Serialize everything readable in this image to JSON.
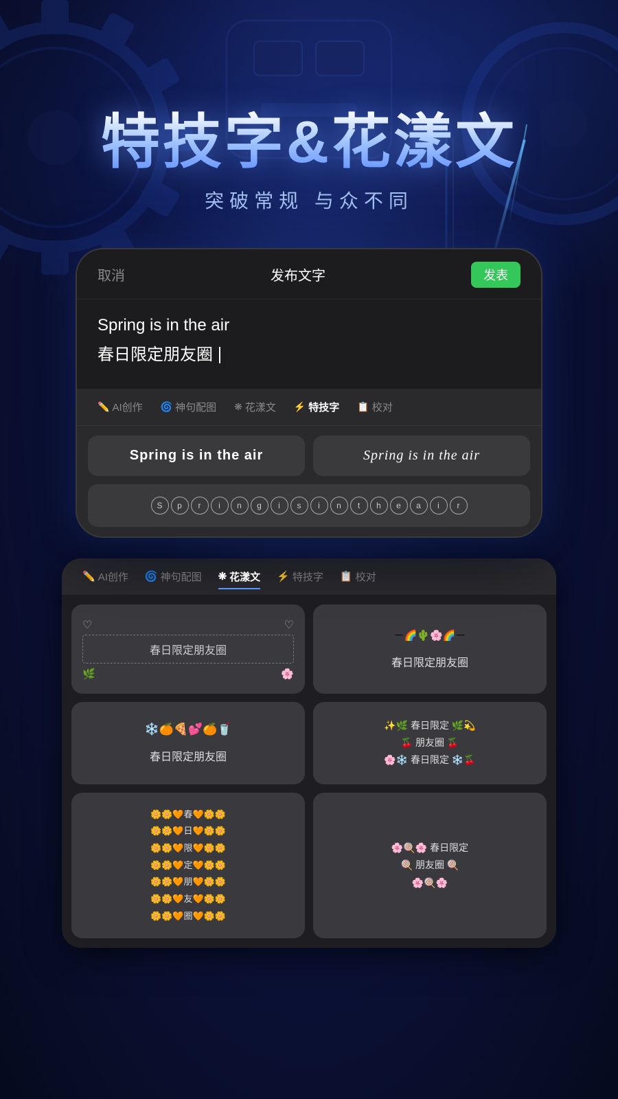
{
  "hero": {
    "title_main": "特技字&花漾文",
    "title_sub": "突破常规 与众不同"
  },
  "phone": {
    "header": {
      "cancel": "取消",
      "title": "发布文字",
      "publish": "发表"
    },
    "content": {
      "line1": "Spring is in the air",
      "line2": "春日限定朋友圈"
    },
    "toolbar_tabs": [
      {
        "label": "AI创作",
        "icon": "✏️",
        "active": false
      },
      {
        "label": "神句配图",
        "icon": "🌀",
        "active": false
      },
      {
        "label": "花漾文",
        "icon": "❋",
        "active": false
      },
      {
        "label": "特技字",
        "icon": "⚡",
        "active": true
      },
      {
        "label": "校对",
        "icon": "📋",
        "active": false
      }
    ],
    "style_option1": "Spring is in the air",
    "style_option2": "Spring is in the air",
    "style_circle_text": "Spring is in the air"
  },
  "bottom_panel": {
    "toolbar_tabs": [
      {
        "label": "AI创作",
        "icon": "✏️",
        "active": false
      },
      {
        "label": "神句配图",
        "icon": "🌀",
        "active": false
      },
      {
        "label": "花漾文",
        "icon": "❋",
        "active": true
      },
      {
        "label": "特技字",
        "icon": "⚡",
        "active": false
      },
      {
        "label": "校对",
        "icon": "📋",
        "active": false
      }
    ],
    "cards": [
      {
        "id": "card1",
        "hearts_top": "♡ ♡",
        "text": "春日限定朋友圈",
        "bottom_emojis": "🌿 🌸"
      },
      {
        "id": "card2",
        "top_emojis": "－🌈🌵🌸🌈－",
        "text": "春日限定朋友圈"
      },
      {
        "id": "card3",
        "top_emojis": "❄️🍊🍕💕🍊🥤",
        "text": "春日限定朋友圈"
      },
      {
        "id": "card4",
        "line1": "✨🌿 春日限定 🌿💫",
        "line2": "🍒 朋友圈 🍒",
        "line3": "🌸❄️ 春日限定 ❄️🍒"
      },
      {
        "id": "card5",
        "line1": "🌼🌼🧡春🧡🌼🌼",
        "line2": "🌼🌼🧡日🧡🌼🌼",
        "line3": "🌼🌼🧡限🧡🌼🌼",
        "line4": "🌼🌼🧡定🧡🌼🌼",
        "line5": "🌼🌼🧡朋🧡🌼🌼",
        "line6": "🌼🌼🧡友🧡🌼🌼",
        "line7": "🌼🌼🧡圈🧡🌼🌼"
      },
      {
        "id": "card6",
        "line1": "🌸🍭🌸 春日限定",
        "line2": "🍭 朋友圈 🍭",
        "line3": "🌸🍭🌸"
      }
    ]
  }
}
